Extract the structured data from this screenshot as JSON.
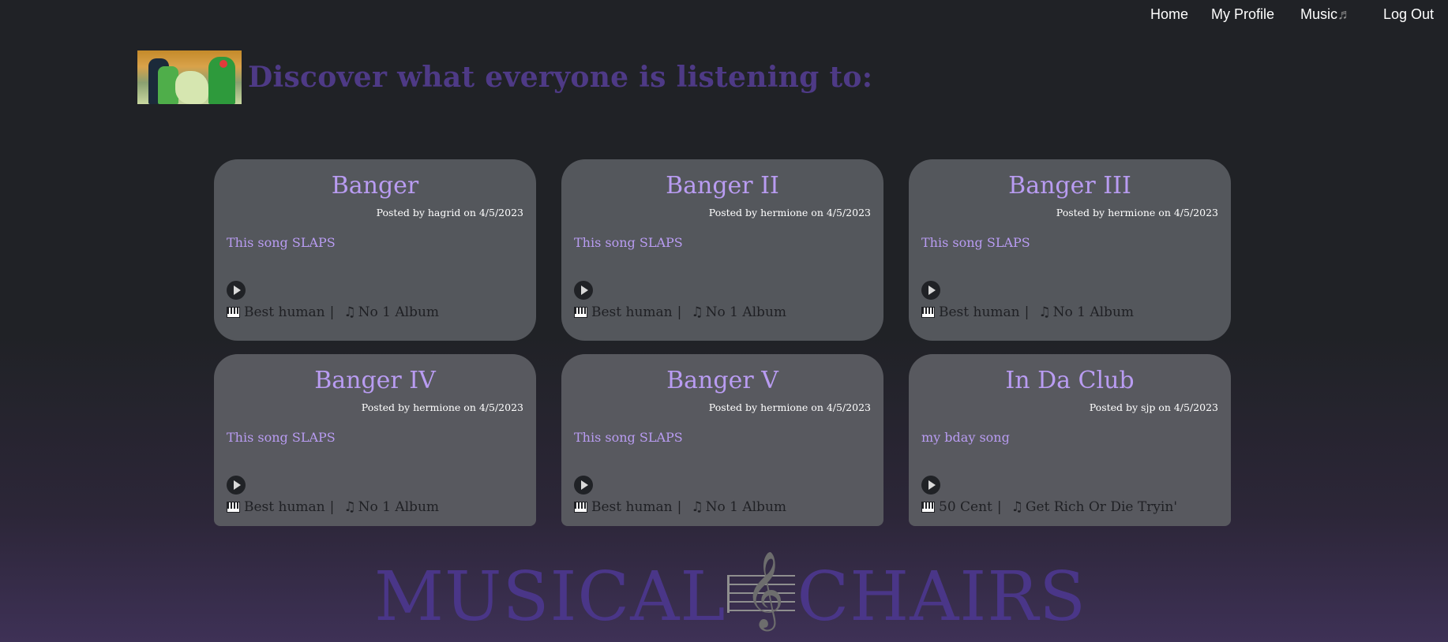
{
  "nav": {
    "home": "Home",
    "profile": "My Profile",
    "music": "Music",
    "music_icon": "♬",
    "logout": "Log Out"
  },
  "header": {
    "title": "Discover what everyone is listening to:"
  },
  "cards": [
    {
      "title": "Banger",
      "meta": "Posted by hagrid on 4/5/2023",
      "description": "This song SLAPS",
      "artist": "Best human",
      "album": "No 1 Album"
    },
    {
      "title": "Banger II",
      "meta": "Posted by hermione on 4/5/2023",
      "description": "This song SLAPS",
      "artist": "Best human",
      "album": "No 1 Album"
    },
    {
      "title": "Banger III",
      "meta": "Posted by hermione on 4/5/2023",
      "description": "This song SLAPS",
      "artist": "Best human",
      "album": "No 1 Album"
    },
    {
      "title": "Banger IV",
      "meta": "Posted by hermione on 4/5/2023",
      "description": "This song SLAPS",
      "artist": "Best human",
      "album": "No 1 Album"
    },
    {
      "title": "Banger V",
      "meta": "Posted by hermione on 4/5/2023",
      "description": "This song SLAPS",
      "artist": "Best human",
      "album": "No 1 Album"
    },
    {
      "title": "In Da Club",
      "meta": "Posted by sjp on 4/5/2023",
      "description": "my bday song",
      "artist": "50 Cent",
      "album": "Get Rich Or Die Tryin'"
    }
  ],
  "footer": {
    "brand_left": "MUSICAL",
    "brand_right": "CHAIRS",
    "clef_icon": "𝄞"
  },
  "icons": {
    "piano": "piano-icon",
    "note": "music-note-icon",
    "play": "play-icon"
  },
  "colors": {
    "background": "#202226",
    "accent": "#b99cf2",
    "title": "#4e3a86",
    "card": "#54575c"
  }
}
